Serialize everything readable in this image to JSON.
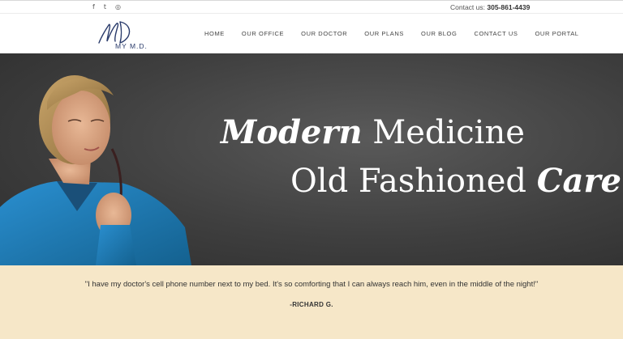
{
  "topbar": {
    "social_icons": [
      "facebook-icon",
      "twitter-icon",
      "instagram-icon"
    ],
    "social_glyphs": [
      "f",
      "t",
      "◎"
    ],
    "contact_label": "Contact us:",
    "contact_phone": "305-861-4439"
  },
  "header": {
    "logo_text": "MY M.D.",
    "nav": [
      "HOME",
      "OUR OFFICE",
      "OUR DOCTOR",
      "OUR PLANS",
      "OUR BLOG",
      "CONTACT US",
      "OUR PORTAL"
    ]
  },
  "hero": {
    "line1_emphasis": "Modern",
    "line1_rest": " Medicine",
    "line2_rest": "Old Fashioned ",
    "line2_emphasis": "Care"
  },
  "testimonial": {
    "quote": "\"I have my doctor's cell phone number next to my bed. It's so comforting that I can always reach him, even in the middle of the night!\"",
    "author": "-RICHARD G."
  },
  "colors": {
    "brand_navy": "#2a3b6b",
    "hero_bg": "#3f3f3f",
    "quote_band": "#f6e7c8",
    "jacket_blue": "#1f7fc0"
  }
}
